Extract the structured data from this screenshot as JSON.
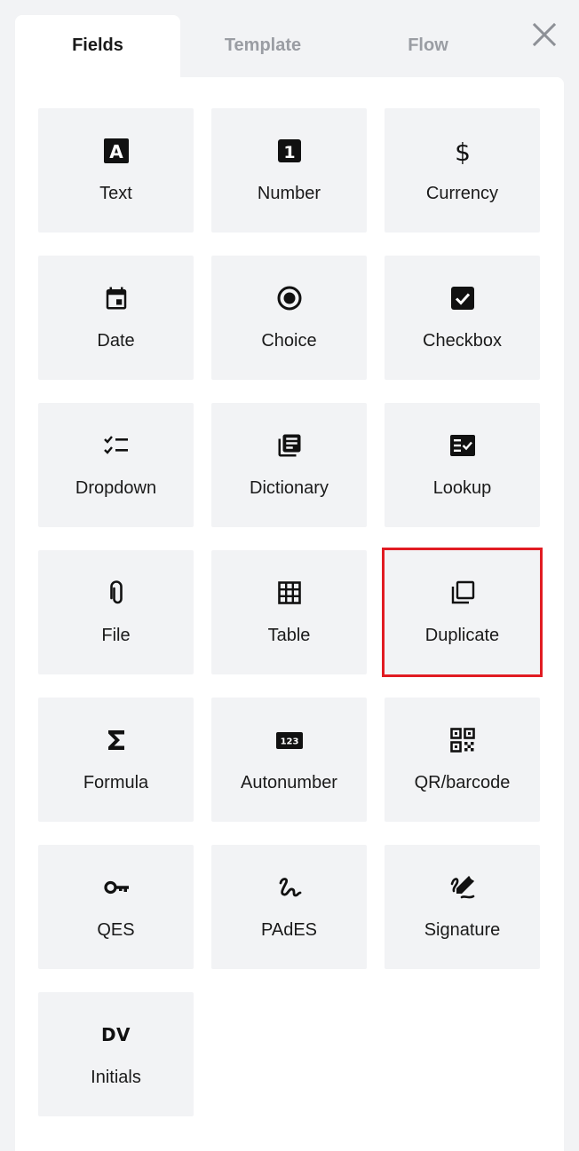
{
  "tabs": [
    {
      "label": "Fields",
      "active": true
    },
    {
      "label": "Template",
      "active": false
    },
    {
      "label": "Flow",
      "active": false
    }
  ],
  "close_icon": "close-icon",
  "fields": [
    {
      "label": "Text",
      "icon": "text-icon",
      "glyph": "A"
    },
    {
      "label": "Number",
      "icon": "number-icon",
      "glyph": "1"
    },
    {
      "label": "Currency",
      "icon": "currency-icon",
      "glyph": "$"
    },
    {
      "label": "Date",
      "icon": "calendar-icon"
    },
    {
      "label": "Choice",
      "icon": "radio-icon"
    },
    {
      "label": "Checkbox",
      "icon": "checkbox-icon"
    },
    {
      "label": "Dropdown",
      "icon": "checklist-icon"
    },
    {
      "label": "Dictionary",
      "icon": "library-books-icon"
    },
    {
      "label": "Lookup",
      "icon": "fact-check-icon"
    },
    {
      "label": "File",
      "icon": "paperclip-icon"
    },
    {
      "label": "Table",
      "icon": "table-grid-icon"
    },
    {
      "label": "Duplicate",
      "icon": "copy-icon",
      "selected": true
    },
    {
      "label": "Formula",
      "icon": "sigma-icon",
      "glyph": "Σ"
    },
    {
      "label": "Autonumber",
      "icon": "autonumber-icon",
      "glyph": "123"
    },
    {
      "label": "QR/barcode",
      "icon": "qr-code-icon"
    },
    {
      "label": "QES",
      "icon": "key-icon"
    },
    {
      "label": "PAdES",
      "icon": "signature-squiggle-icon"
    },
    {
      "label": "Signature",
      "icon": "pen-signature-icon"
    },
    {
      "label": "Initials",
      "icon": "initials-icon",
      "glyph": "DV"
    }
  ],
  "colors": {
    "background": "#f2f3f5",
    "panel": "#ffffff",
    "tile": "#f2f3f5",
    "active_tab_text": "#1a1a1a",
    "inactive_tab_text": "#9a9da3",
    "highlight_border": "#e11b22"
  }
}
